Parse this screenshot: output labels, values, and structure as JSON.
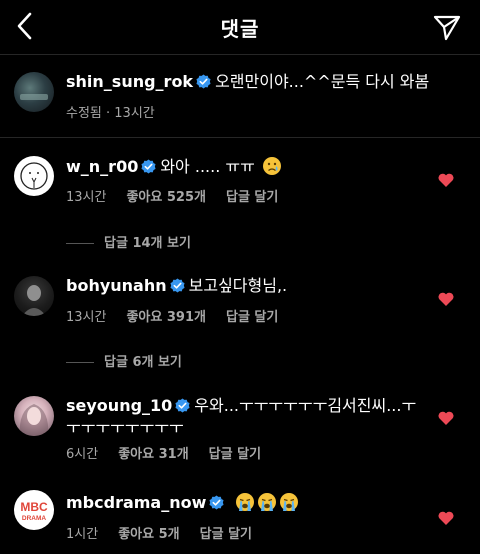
{
  "header": {
    "title": "댓글"
  },
  "caption": {
    "username": "shin_sung_rok",
    "text": "오랜만이야...^^문득 다시 와봄",
    "meta": "수정됨 · 13시간"
  },
  "comments": [
    {
      "username": "w_n_r00",
      "text": "와아 ..... ㅠㅠ",
      "emoji": [
        "crying-face"
      ],
      "time": "13시간",
      "likes": "좋아요 525개",
      "reply_label": "답글 달기",
      "view_replies": "답글 14개 보기"
    },
    {
      "username": "bohyunahn",
      "text": "보고싶다형님,.",
      "time": "13시간",
      "likes": "좋아요 391개",
      "reply_label": "답글 달기",
      "view_replies": "답글 6개 보기"
    },
    {
      "username": "seyoung_10",
      "text": "우와...ㅜㅜㅜㅜㅜㅜ김서진씨...ㅜ",
      "text2": "ㅜㅜㅜㅜㅜㅜㅜㅜ",
      "time": "6시간",
      "likes": "좋아요 31개",
      "reply_label": "답글 달기"
    },
    {
      "username": "mbcdrama_now",
      "text": "",
      "emoji": [
        "loudly-crying-face",
        "loudly-crying-face",
        "loudly-crying-face"
      ],
      "time": "1시간",
      "likes": "좋아요 5개",
      "reply_label": "답글 달기"
    }
  ],
  "mbc_logo": {
    "top": "MBC",
    "bottom": "DRAMA"
  },
  "colors": {
    "background": "#000000",
    "verified": "#3897f0",
    "heart": "#ed4956",
    "meta": "#a8a8a8"
  },
  "icons": {
    "back": "chevron-left-icon",
    "send": "paper-plane-icon",
    "verified": "verified-badge-icon",
    "heart": "heart-icon"
  }
}
